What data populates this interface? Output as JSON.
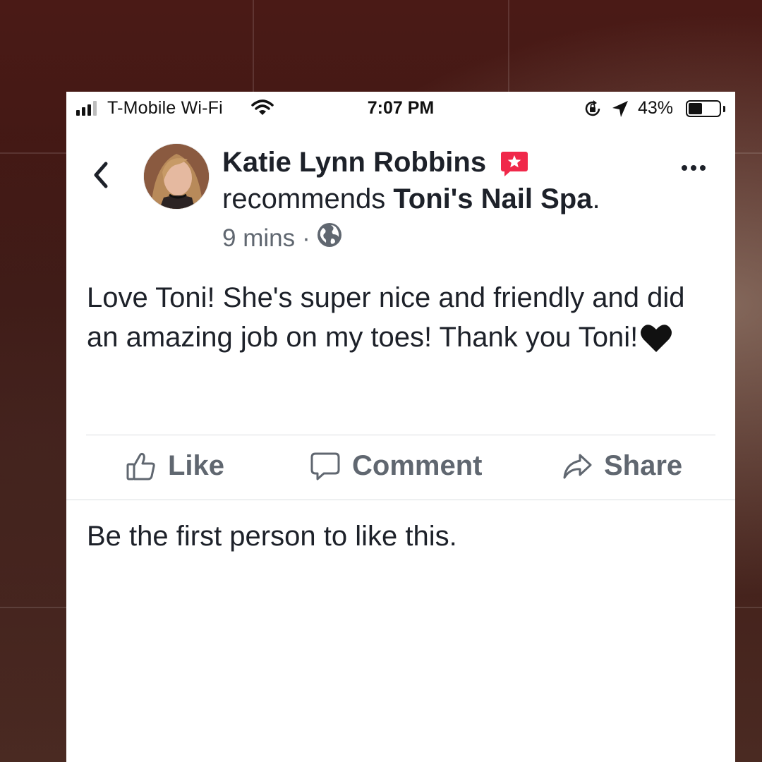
{
  "colors": {
    "text_primary": "#1d2129",
    "text_secondary": "#606770",
    "badge_red": "#f0284a",
    "divider": "#dadde1"
  },
  "status_bar": {
    "carrier": "T-Mobile Wi-Fi",
    "time": "7:07 PM",
    "battery_percent": "43%",
    "battery_level": 0.43,
    "icons": [
      "signal-bars-icon",
      "wifi-icon",
      "rotation-lock-icon",
      "location-arrow-icon",
      "battery-icon"
    ]
  },
  "post": {
    "author": "Katie Lynn Robbins",
    "action_text": "recommends",
    "page_name": "Toni's Nail Spa",
    "page_punct": ".",
    "time_ago": "9 mins",
    "separator": "·",
    "privacy_icon": "globe-icon",
    "body": "Love Toni! She's super nice and friendly and did an amazing job on my toes! Thank you Toni!",
    "body_emoji": "black-heart"
  },
  "actions": {
    "like": "Like",
    "comment": "Comment",
    "share": "Share"
  },
  "likes_summary": "Be the first person to like this."
}
